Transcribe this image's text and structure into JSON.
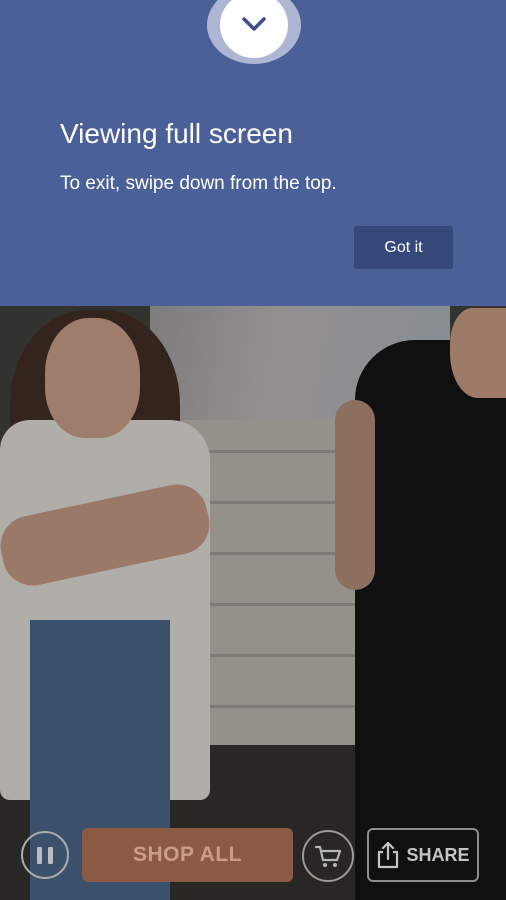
{
  "banner": {
    "title": "Viewing full screen",
    "message": "To exit, swipe down from the top.",
    "button_label": "Got it",
    "icon": "chevron-down-icon"
  },
  "controls": {
    "pause_icon": "pause-icon",
    "shop_all_label": "SHOP ALL",
    "cart_icon": "cart-icon",
    "share_icon": "share-icon",
    "share_label": "SHARE"
  },
  "colors": {
    "banner_bg": "#4b6098",
    "button_bg": "#36477a",
    "shop_all_bg": "#8a5a45"
  }
}
